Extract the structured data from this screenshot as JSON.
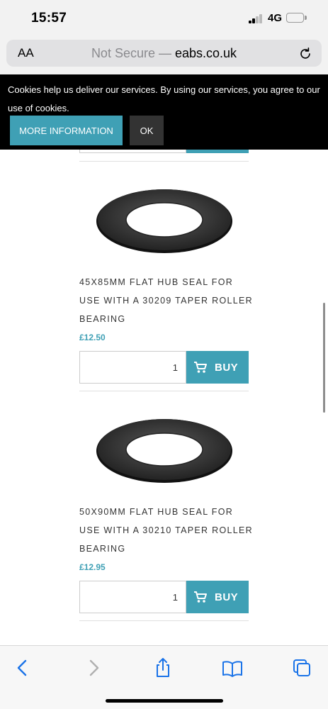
{
  "status_bar": {
    "time": "15:57",
    "network": "4G"
  },
  "address_bar": {
    "aa_label": "AA",
    "prefix": "Not Secure — ",
    "domain": "eabs.co.uk"
  },
  "cookie_banner": {
    "text": "Cookies help us deliver our services. By using our services, you agree to our use of cookies.",
    "more_label": "MORE INFORMATION",
    "ok_label": "OK"
  },
  "products": [
    {
      "title": "45X85MM FLAT HUB SEAL FOR USE WITH A 30209 TAPER ROLLER BEARING",
      "price": "£12.50",
      "quantity": "1",
      "buy_label": "BUY"
    },
    {
      "title": "50X90MM FLAT HUB SEAL FOR USE WITH A 30210 TAPER ROLLER BEARING",
      "price": "£12.95",
      "quantity": "1",
      "buy_label": "BUY"
    }
  ],
  "colors": {
    "accent": "#3fa0b5",
    "cookie_bg": "#000000",
    "ok_button": "#333333",
    "toolbar_icon": "#1a73e8"
  },
  "icons": [
    "signal-icon",
    "battery-icon",
    "reload-icon",
    "cart-icon",
    "back-icon",
    "forward-icon",
    "share-icon",
    "bookmarks-icon",
    "tabs-icon"
  ]
}
